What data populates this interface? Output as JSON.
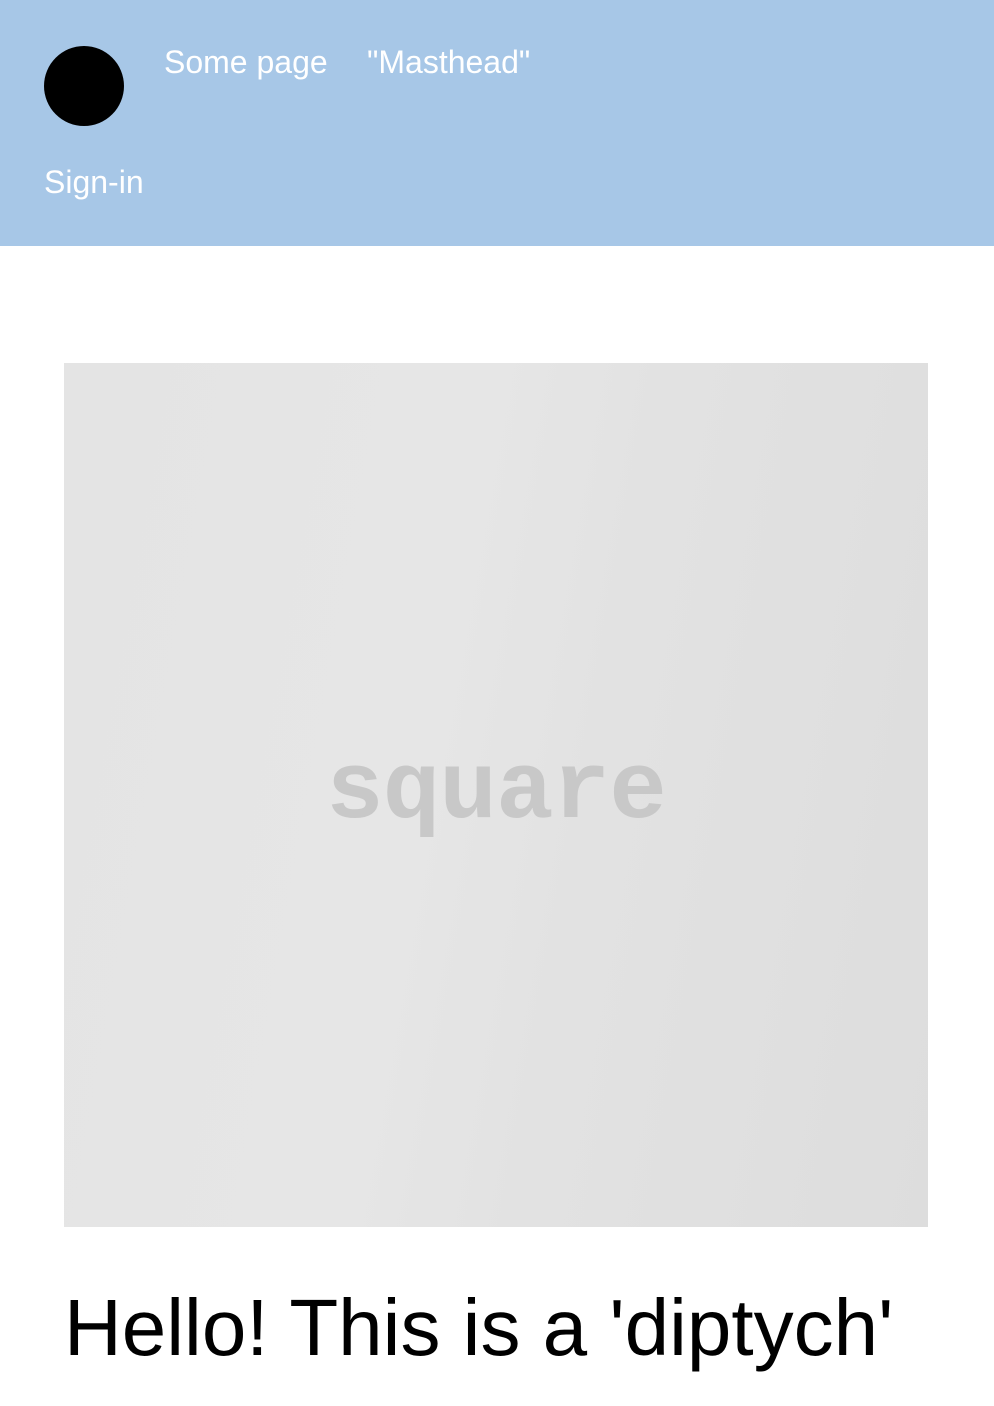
{
  "header": {
    "nav": [
      {
        "label": "Some page"
      },
      {
        "label": "\"Masthead\""
      }
    ],
    "signin_label": "Sign-in",
    "logo_icon": "circle-logo-icon"
  },
  "main": {
    "image_label": "square",
    "heading": "Hello! This is a 'diptych'"
  },
  "colors": {
    "masthead_bg": "#a7c7e7",
    "nav_text": "#ffffff",
    "logo": "#000000",
    "placeholder_bg": "#e2e2e2",
    "placeholder_text": "#c8c8c8"
  }
}
